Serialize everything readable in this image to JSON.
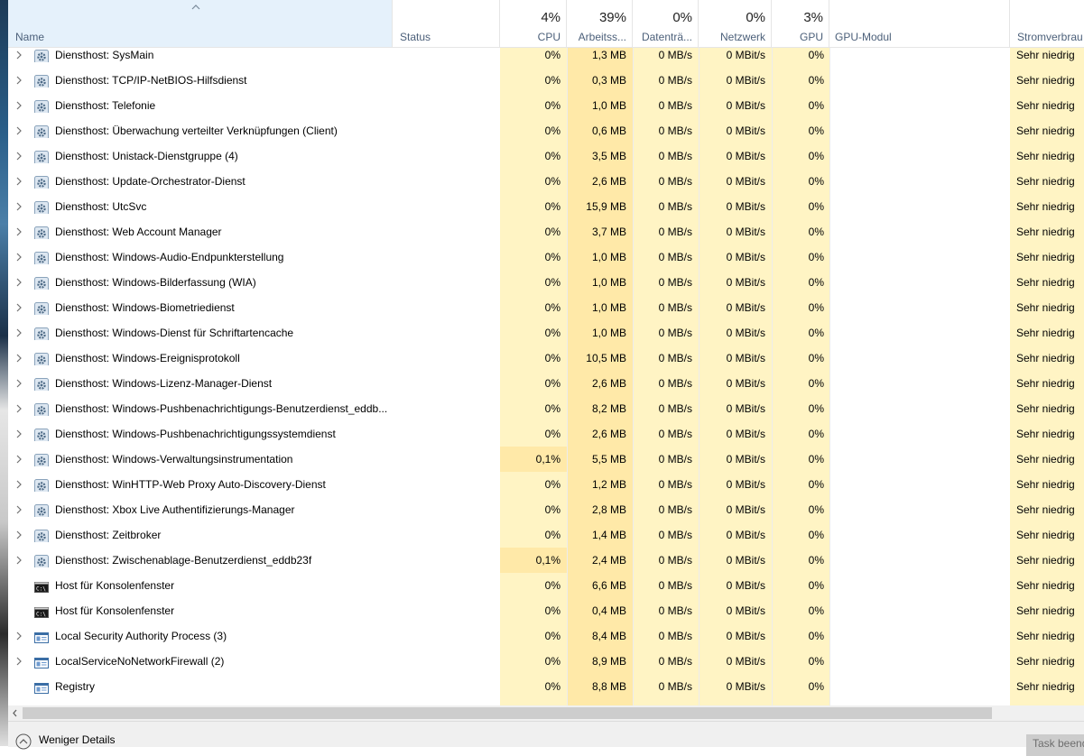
{
  "header": {
    "name": "Name",
    "status": "Status",
    "cpu": {
      "pct": "4%",
      "label": "CPU"
    },
    "memory": {
      "pct": "39%",
      "label": "Arbeitss..."
    },
    "disk": {
      "pct": "0%",
      "label": "Datenträ..."
    },
    "network": {
      "pct": "0%",
      "label": "Netzwerk"
    },
    "gpu": {
      "pct": "3%",
      "label": "GPU"
    },
    "gpu_engine": "GPU-Modul",
    "power": "Stromverbrau"
  },
  "rows": [
    {
      "name": "Diensthost: SysMain",
      "icon": "gear-icon",
      "expand": true,
      "cpu": "0%",
      "mem": "1,3 MB",
      "disk": "0 MB/s",
      "net": "0 MBit/s",
      "gpu": "0%",
      "power": "Sehr niedrig"
    },
    {
      "name": "Diensthost: TCP/IP-NetBIOS-Hilfsdienst",
      "icon": "gear-icon",
      "expand": true,
      "cpu": "0%",
      "mem": "0,3 MB",
      "disk": "0 MB/s",
      "net": "0 MBit/s",
      "gpu": "0%",
      "power": "Sehr niedrig"
    },
    {
      "name": "Diensthost: Telefonie",
      "icon": "gear-icon",
      "expand": true,
      "cpu": "0%",
      "mem": "1,0 MB",
      "disk": "0 MB/s",
      "net": "0 MBit/s",
      "gpu": "0%",
      "power": "Sehr niedrig"
    },
    {
      "name": "Diensthost: Überwachung verteilter Verknüpfungen (Client)",
      "icon": "gear-icon",
      "expand": true,
      "cpu": "0%",
      "mem": "0,6 MB",
      "disk": "0 MB/s",
      "net": "0 MBit/s",
      "gpu": "0%",
      "power": "Sehr niedrig"
    },
    {
      "name": "Diensthost: Unistack-Dienstgruppe (4)",
      "icon": "gear-icon",
      "expand": true,
      "cpu": "0%",
      "mem": "3,5 MB",
      "disk": "0 MB/s",
      "net": "0 MBit/s",
      "gpu": "0%",
      "power": "Sehr niedrig"
    },
    {
      "name": "Diensthost: Update-Orchestrator-Dienst",
      "icon": "gear-icon",
      "expand": true,
      "cpu": "0%",
      "mem": "2,6 MB",
      "disk": "0 MB/s",
      "net": "0 MBit/s",
      "gpu": "0%",
      "power": "Sehr niedrig"
    },
    {
      "name": "Diensthost: UtcSvc",
      "icon": "gear-icon",
      "expand": true,
      "cpu": "0%",
      "mem": "15,9 MB",
      "disk": "0 MB/s",
      "net": "0 MBit/s",
      "gpu": "0%",
      "power": "Sehr niedrig"
    },
    {
      "name": "Diensthost: Web Account Manager",
      "icon": "gear-icon",
      "expand": true,
      "cpu": "0%",
      "mem": "3,7 MB",
      "disk": "0 MB/s",
      "net": "0 MBit/s",
      "gpu": "0%",
      "power": "Sehr niedrig"
    },
    {
      "name": "Diensthost: Windows-Audio-Endpunkterstellung",
      "icon": "gear-icon",
      "expand": true,
      "cpu": "0%",
      "mem": "1,0 MB",
      "disk": "0 MB/s",
      "net": "0 MBit/s",
      "gpu": "0%",
      "power": "Sehr niedrig"
    },
    {
      "name": "Diensthost: Windows-Bilderfassung (WIA)",
      "icon": "gear-icon",
      "expand": true,
      "cpu": "0%",
      "mem": "1,0 MB",
      "disk": "0 MB/s",
      "net": "0 MBit/s",
      "gpu": "0%",
      "power": "Sehr niedrig"
    },
    {
      "name": "Diensthost: Windows-Biometriedienst",
      "icon": "gear-icon",
      "expand": true,
      "cpu": "0%",
      "mem": "1,0 MB",
      "disk": "0 MB/s",
      "net": "0 MBit/s",
      "gpu": "0%",
      "power": "Sehr niedrig"
    },
    {
      "name": "Diensthost: Windows-Dienst für Schriftartencache",
      "icon": "gear-icon",
      "expand": true,
      "cpu": "0%",
      "mem": "1,0 MB",
      "disk": "0 MB/s",
      "net": "0 MBit/s",
      "gpu": "0%",
      "power": "Sehr niedrig"
    },
    {
      "name": "Diensthost: Windows-Ereignisprotokoll",
      "icon": "gear-icon",
      "expand": true,
      "cpu": "0%",
      "mem": "10,5 MB",
      "disk": "0 MB/s",
      "net": "0 MBit/s",
      "gpu": "0%",
      "power": "Sehr niedrig"
    },
    {
      "name": "Diensthost: Windows-Lizenz-Manager-Dienst",
      "icon": "gear-icon",
      "expand": true,
      "cpu": "0%",
      "mem": "2,6 MB",
      "disk": "0 MB/s",
      "net": "0 MBit/s",
      "gpu": "0%",
      "power": "Sehr niedrig"
    },
    {
      "name": "Diensthost: Windows-Pushbenachrichtigungs-Benutzerdienst_eddb...",
      "icon": "gear-icon",
      "expand": true,
      "cpu": "0%",
      "mem": "8,2 MB",
      "disk": "0 MB/s",
      "net": "0 MBit/s",
      "gpu": "0%",
      "power": "Sehr niedrig"
    },
    {
      "name": "Diensthost: Windows-Pushbenachrichtigungssystemdienst",
      "icon": "gear-icon",
      "expand": true,
      "cpu": "0%",
      "mem": "2,6 MB",
      "disk": "0 MB/s",
      "net": "0 MBit/s",
      "gpu": "0%",
      "power": "Sehr niedrig"
    },
    {
      "name": "Diensthost: Windows-Verwaltungsinstrumentation",
      "icon": "gear-icon",
      "expand": true,
      "cpu": "0,1%",
      "cpu_hot": true,
      "mem": "5,5 MB",
      "disk": "0 MB/s",
      "net": "0 MBit/s",
      "gpu": "0%",
      "power": "Sehr niedrig"
    },
    {
      "name": "Diensthost: WinHTTP-Web Proxy Auto-Discovery-Dienst",
      "icon": "gear-icon",
      "expand": true,
      "cpu": "0%",
      "mem": "1,2 MB",
      "disk": "0 MB/s",
      "net": "0 MBit/s",
      "gpu": "0%",
      "power": "Sehr niedrig"
    },
    {
      "name": "Diensthost: Xbox Live Authentifizierungs-Manager",
      "icon": "gear-icon",
      "expand": true,
      "cpu": "0%",
      "mem": "2,8 MB",
      "disk": "0 MB/s",
      "net": "0 MBit/s",
      "gpu": "0%",
      "power": "Sehr niedrig"
    },
    {
      "name": "Diensthost: Zeitbroker",
      "icon": "gear-icon",
      "expand": true,
      "cpu": "0%",
      "mem": "1,4 MB",
      "disk": "0 MB/s",
      "net": "0 MBit/s",
      "gpu": "0%",
      "power": "Sehr niedrig"
    },
    {
      "name": "Diensthost: Zwischenablage-Benutzerdienst_eddb23f",
      "icon": "gear-icon",
      "expand": true,
      "cpu": "0,1%",
      "cpu_hot": true,
      "mem": "2,4 MB",
      "disk": "0 MB/s",
      "net": "0 MBit/s",
      "gpu": "0%",
      "power": "Sehr niedrig"
    },
    {
      "name": "Host für Konsolenfenster",
      "icon": "console-icon",
      "expand": false,
      "cpu": "0%",
      "mem": "6,6 MB",
      "disk": "0 MB/s",
      "net": "0 MBit/s",
      "gpu": "0%",
      "power": "Sehr niedrig"
    },
    {
      "name": "Host für Konsolenfenster",
      "icon": "console-icon",
      "expand": false,
      "cpu": "0%",
      "mem": "0,4 MB",
      "disk": "0 MB/s",
      "net": "0 MBit/s",
      "gpu": "0%",
      "power": "Sehr niedrig"
    },
    {
      "name": "Local Security Authority Process (3)",
      "icon": "window-app-icon",
      "expand": true,
      "cpu": "0%",
      "mem": "8,4 MB",
      "disk": "0 MB/s",
      "net": "0 MBit/s",
      "gpu": "0%",
      "power": "Sehr niedrig"
    },
    {
      "name": "LocalServiceNoNetworkFirewall (2)",
      "icon": "window-app-icon",
      "expand": true,
      "cpu": "0%",
      "mem": "8,9 MB",
      "disk": "0 MB/s",
      "net": "0 MBit/s",
      "gpu": "0%",
      "power": "Sehr niedrig"
    },
    {
      "name": "Registry",
      "icon": "window-app-icon",
      "expand": false,
      "cpu": "0%",
      "mem": "8,8 MB",
      "disk": "0 MB/s",
      "net": "0 MBit/s",
      "gpu": "0%",
      "power": "Sehr niedrig"
    }
  ],
  "footer": {
    "fewer_details": "Weniger Details",
    "end_task": "Task beenden"
  },
  "colors": {
    "heat_light": "#fff4c4",
    "heat_medium": "#ffe9a8",
    "header_label": "#4c607a",
    "sorted_header_bg": "#e5f1fb"
  }
}
